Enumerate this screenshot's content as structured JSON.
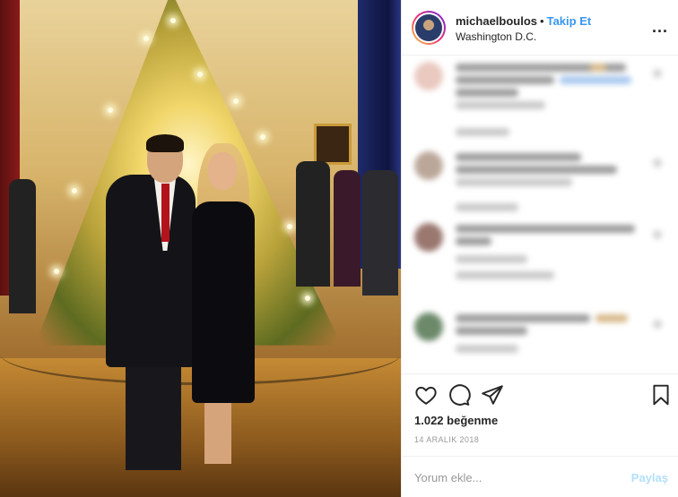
{
  "post": {
    "photo_icon": "christmas-tree-photo"
  },
  "header": {
    "username": "michaelboulos",
    "separator": "•",
    "follow_label": "Takip Et",
    "location": "Washington D.C.",
    "more_label": "..."
  },
  "actions": {
    "like_icon": "heart-icon",
    "comment_icon": "comment-icon",
    "share_icon": "share-icon",
    "save_icon": "bookmark-icon"
  },
  "likes": {
    "text": "1.022 beğenme"
  },
  "date": {
    "text": "14 ARALIK 2018"
  },
  "comment_box": {
    "placeholder": "Yorum ekle...",
    "post_label": "Paylaş"
  },
  "colors": {
    "accent": "#3897f0",
    "post_disabled": "#b2dffc"
  }
}
